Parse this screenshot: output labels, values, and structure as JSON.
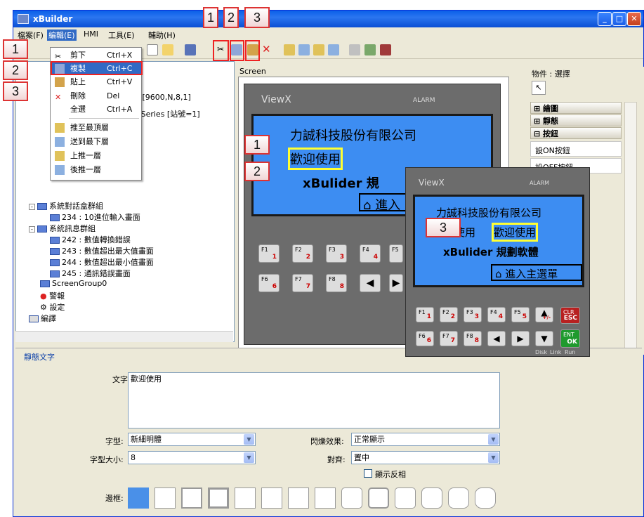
{
  "window": {
    "title": "xBuilder"
  },
  "menubar": {
    "items": [
      "檔案(F)",
      "編輯(E)",
      "HMI",
      "工具(E)",
      "輔助(H)"
    ]
  },
  "edit_menu": {
    "items": [
      {
        "label": "剪下",
        "shortcut": "Ctrl+X"
      },
      {
        "label": "複製",
        "shortcut": "Ctrl+C"
      },
      {
        "label": "貼上",
        "shortcut": "Ctrl+V"
      },
      {
        "label": "刪除",
        "shortcut": "Del"
      },
      {
        "label": "全選",
        "shortcut": "Ctrl+A"
      },
      {
        "label": "推至最頂層",
        "shortcut": ""
      },
      {
        "label": "送到最下層",
        "shortcut": ""
      },
      {
        "label": "上推一層",
        "shortcut": ""
      },
      {
        "label": "後推一層",
        "shortcut": ""
      }
    ]
  },
  "callouts": {
    "n1": "1",
    "n2": "2",
    "n3": "3"
  },
  "tree": {
    "partial1": "Mode [9600,N,8,1]",
    "partial2": "ollor Series [站號=1]",
    "items": [
      "系統對話盒群組",
      "234 : 10進位輸入畫面",
      "系統訊息群組",
      "242 : 數值轉換錯誤",
      "243 : 數值超出最大值畫面",
      "244 : 數值超出最小值畫面",
      "245 : 通訊錯誤畫面",
      "ScreenGroup0",
      "警報",
      "設定",
      "編譯"
    ]
  },
  "screen": {
    "label": "Screen",
    "brand": "ViewX",
    "alarm": "ALARM",
    "line1": "力誠科技股份有限公司",
    "line2": "歡迎使用",
    "line3a": "xBulider",
    "line3b": "規劃軟體",
    "line3b_short": "規",
    "home": "進入主選單",
    "home_short": "進入",
    "line2_prefix": "使用",
    "keys_row1": [
      [
        "F1",
        "1"
      ],
      [
        "F2",
        "2"
      ],
      [
        "F3",
        "3"
      ],
      [
        "F4",
        "4"
      ],
      [
        "F5",
        "5"
      ]
    ],
    "keys_row2": [
      [
        "F6",
        "6"
      ],
      [
        "F7",
        "7"
      ],
      [
        "F8",
        "8"
      ]
    ],
    "extra": {
      "clr": "CLR",
      "esc": "ESC",
      "ent": "ENT",
      "ok": "OK",
      "pm": "+/-",
      "disk": "Disk",
      "link": "Link",
      "run": "Run"
    }
  },
  "palette": {
    "header": "物件 : 選擇",
    "cats": [
      "繪圖",
      "靜態",
      "按鈕"
    ],
    "item": "設ON按鈕",
    "item2": "設OFF按鈕"
  },
  "props": {
    "section": "靜態文字",
    "text_label": "文字:",
    "text_value": "歡迎使用",
    "font_label": "字型:",
    "font_value": "新細明體",
    "size_label": "字型大小:",
    "size_value": "8",
    "blink_label": "閃爍效果:",
    "blink_value": "正常顯示",
    "align_label": "對齊:",
    "align_value": "置中",
    "invert_label": "顯示反相",
    "border_label": "邊框:"
  },
  "colors": {
    "accent": "#316ac5",
    "callout_border": "#dd3333",
    "lcd": "#3d8df2",
    "highlight": "#ffff33"
  }
}
